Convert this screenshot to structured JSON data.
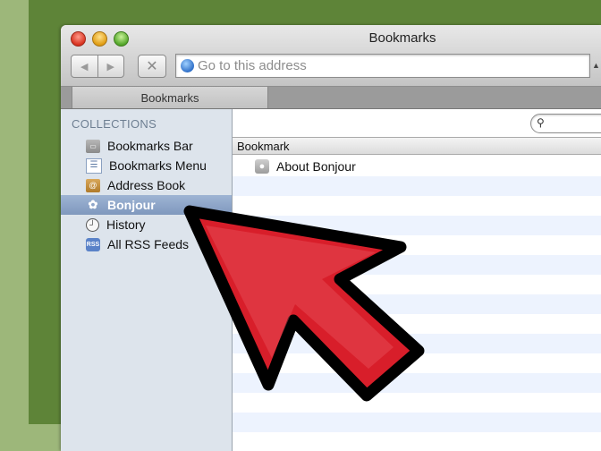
{
  "window": {
    "title": "Bookmarks"
  },
  "toolbar": {
    "back_icon": "back-arrow-icon",
    "forward_icon": "forward-arrow-icon",
    "stop_label": "✕",
    "address_placeholder": "Go to this address"
  },
  "tab": {
    "label": "Bookmarks"
  },
  "sidebar": {
    "heading": "COLLECTIONS",
    "items": [
      {
        "label": "Bookmarks Bar",
        "icon": "bookmarks-bar-icon",
        "selected": false
      },
      {
        "label": "Bookmarks Menu",
        "icon": "bookmarks-menu-icon",
        "selected": false
      },
      {
        "label": "Address Book",
        "icon": "address-book-icon",
        "selected": false
      },
      {
        "label": "Bonjour",
        "icon": "bonjour-icon",
        "selected": true
      },
      {
        "label": "History",
        "icon": "clock-icon",
        "selected": false
      },
      {
        "label": "All RSS Feeds",
        "icon": "rss-icon",
        "selected": false
      }
    ]
  },
  "list": {
    "column_header": "Bookmark",
    "rows": [
      {
        "label": "About Bonjour",
        "icon": "apple-icon"
      }
    ]
  },
  "overlay": {
    "icon": "red-pointer-arrow",
    "color": "#d81e2a"
  },
  "colors": {
    "background_outer": "#9db77a",
    "background_inner": "#5e8438",
    "sidebar": "#dde4ec",
    "selection": "#8fa7c8",
    "row_stripe": "#edf3fe"
  }
}
